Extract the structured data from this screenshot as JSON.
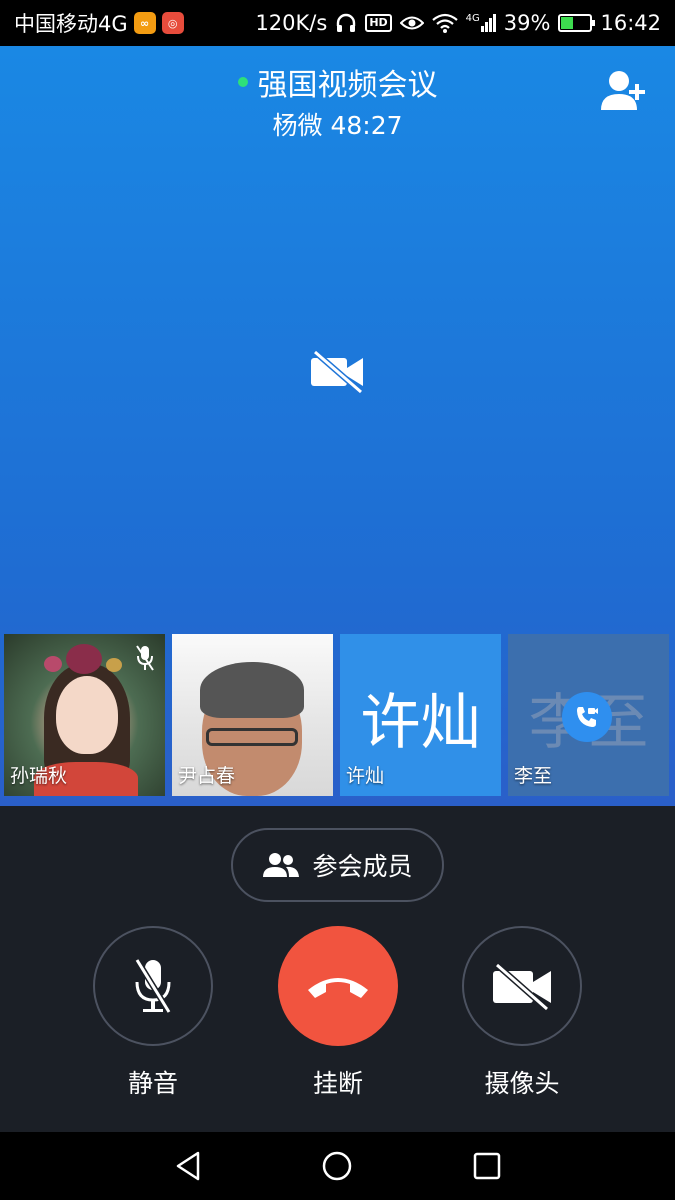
{
  "status_bar": {
    "carrier": "中国移动4G",
    "speed": "120K/s",
    "hd": "HD",
    "network": "4G",
    "battery_percent": "39%",
    "battery_level": 0.39,
    "time": "16:42"
  },
  "meeting": {
    "title": "强国视频会议",
    "host": "杨微",
    "duration": "48:27"
  },
  "participants": [
    {
      "name": "孙瑞秋",
      "type": "video",
      "muted": true
    },
    {
      "name": "尹占春",
      "type": "video",
      "muted": false
    },
    {
      "name": "许灿",
      "type": "avatar",
      "avatar_text": "许灿"
    },
    {
      "name": "李至",
      "type": "calling",
      "avatar_text": "李至"
    }
  ],
  "controls": {
    "participants_button": "参会成员",
    "mute_label": "静音",
    "hangup_label": "挂断",
    "camera_label": "摄像头"
  },
  "colors": {
    "accent_blue": "#1a88e4",
    "hangup_red": "#f1543f",
    "online_green": "#2ee07a",
    "panel_bg": "#1b1f26"
  }
}
